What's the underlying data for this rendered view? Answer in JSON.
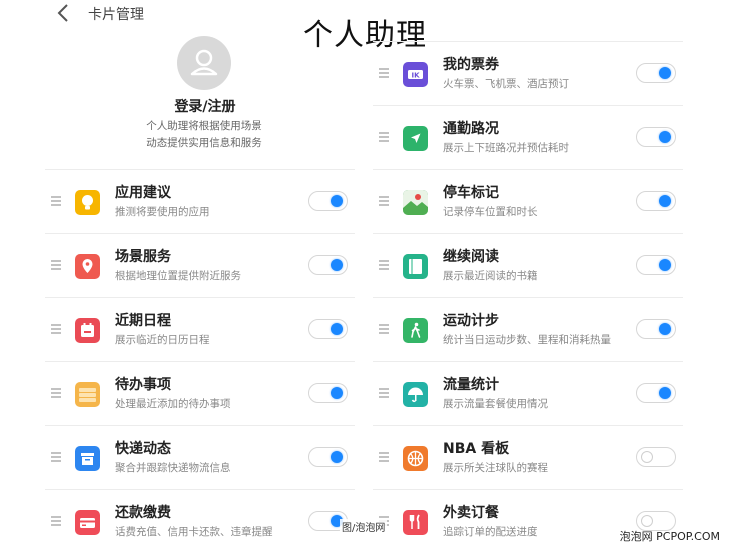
{
  "header": {
    "title": "卡片管理"
  },
  "overlay_title": "个人助理",
  "profile": {
    "login_label": "登录/注册",
    "description_line1": "个人助理将根据使用场景",
    "description_line2": "动态提供实用信息和服务"
  },
  "left_cards": [
    {
      "title": "应用建议",
      "desc": "推测将要使用的应用",
      "icon": "lightbulb-icon",
      "color": "#f7b500",
      "on": true
    },
    {
      "title": "场景服务",
      "desc": "根据地理位置提供附近服务",
      "icon": "location-pin-icon",
      "color": "#ef5a50",
      "on": true
    },
    {
      "title": "近期日程",
      "desc": "展示临近的日历日程",
      "icon": "calendar-icon",
      "color": "#ea4b55",
      "on": true
    },
    {
      "title": "待办事项",
      "desc": "处理最近添加的待办事项",
      "icon": "todo-list-icon",
      "color": "#f5b54a",
      "on": true
    },
    {
      "title": "快递动态",
      "desc": "聚合并跟踪快递物流信息",
      "icon": "parcel-box-icon",
      "color": "#2d86f0",
      "on": true
    },
    {
      "title": "还款缴费",
      "desc": "话费充值、信用卡还款、违章提醒",
      "icon": "credit-card-icon",
      "color": "#ef4c58",
      "on": true
    }
  ],
  "right_cards": [
    {
      "title": "我的票券",
      "desc": "火车票、飞机票、酒店预订",
      "icon": "ticket-icon",
      "color": "#6a4fd8",
      "on": true
    },
    {
      "title": "通勤路况",
      "desc": "展示上下班路况并预估耗时",
      "icon": "navigation-arrow-icon",
      "color": "#2db36b",
      "on": true
    },
    {
      "title": "停车标记",
      "desc": "记录停车位置和时长",
      "icon": "parking-map-icon",
      "color": "#3aa35a",
      "on": true
    },
    {
      "title": "继续阅读",
      "desc": "展示最近阅读的书籍",
      "icon": "book-icon",
      "color": "#25b38a",
      "on": true
    },
    {
      "title": "运动计步",
      "desc": "统计当日运动步数、里程和消耗热量",
      "icon": "walking-person-icon",
      "color": "#34b567",
      "on": true
    },
    {
      "title": "流量统计",
      "desc": "展示流量套餐使用情况",
      "icon": "data-usage-icon",
      "color": "#22b2a6",
      "on": true
    },
    {
      "title": "NBA 看板",
      "desc": "展示所关注球队的赛程",
      "icon": "basketball-icon",
      "color": "#f07a2c",
      "on": false
    },
    {
      "title": "外卖订餐",
      "desc": "追踪订单的配送进度",
      "icon": "food-delivery-icon",
      "color": "#ef4c58",
      "on": false
    }
  ],
  "watermark": {
    "center": "图/泡泡网",
    "corner": "泡泡网 PCPOP.COM"
  }
}
